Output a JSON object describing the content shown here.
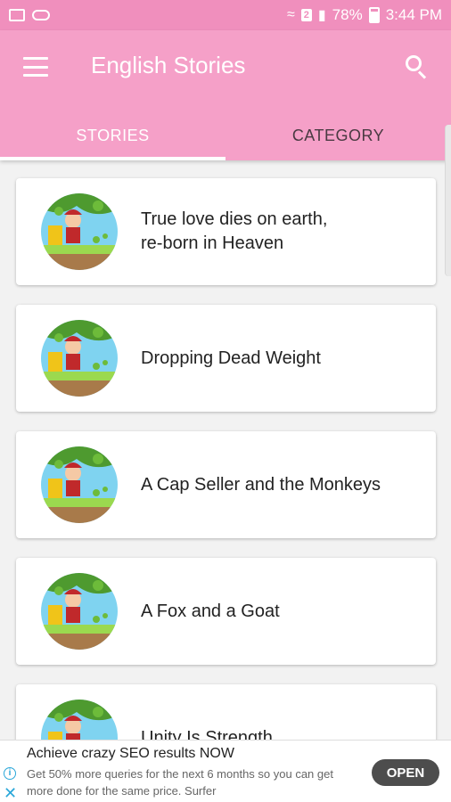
{
  "status_bar": {
    "battery": "78%",
    "time": "3:44 PM",
    "sim_badge": "2"
  },
  "app_bar": {
    "title": "English Stories"
  },
  "tabs": [
    {
      "label": "STORIES",
      "active": true
    },
    {
      "label": "CATEGORY",
      "active": false
    }
  ],
  "stories": [
    {
      "title_line1": "True love dies on earth,",
      "title_line2": "re-born in Heaven"
    },
    {
      "title_line1": "Dropping Dead Weight",
      "title_line2": ""
    },
    {
      "title_line1": "A Cap Seller and the Monkeys",
      "title_line2": ""
    },
    {
      "title_line1": "A Fox and a Goat",
      "title_line2": ""
    },
    {
      "title_line1": "Unity Is Strength",
      "title_line2": ""
    }
  ],
  "ad": {
    "title": "Achieve crazy SEO results NOW",
    "body": "Get 50% more queries for the next 6 months so you can get more done for the same price. Surfer",
    "button": "OPEN"
  },
  "colors": {
    "status_bar": "#f08fbd",
    "app_bar": "#f5a0c8",
    "ad_button": "#4d4d4d"
  }
}
